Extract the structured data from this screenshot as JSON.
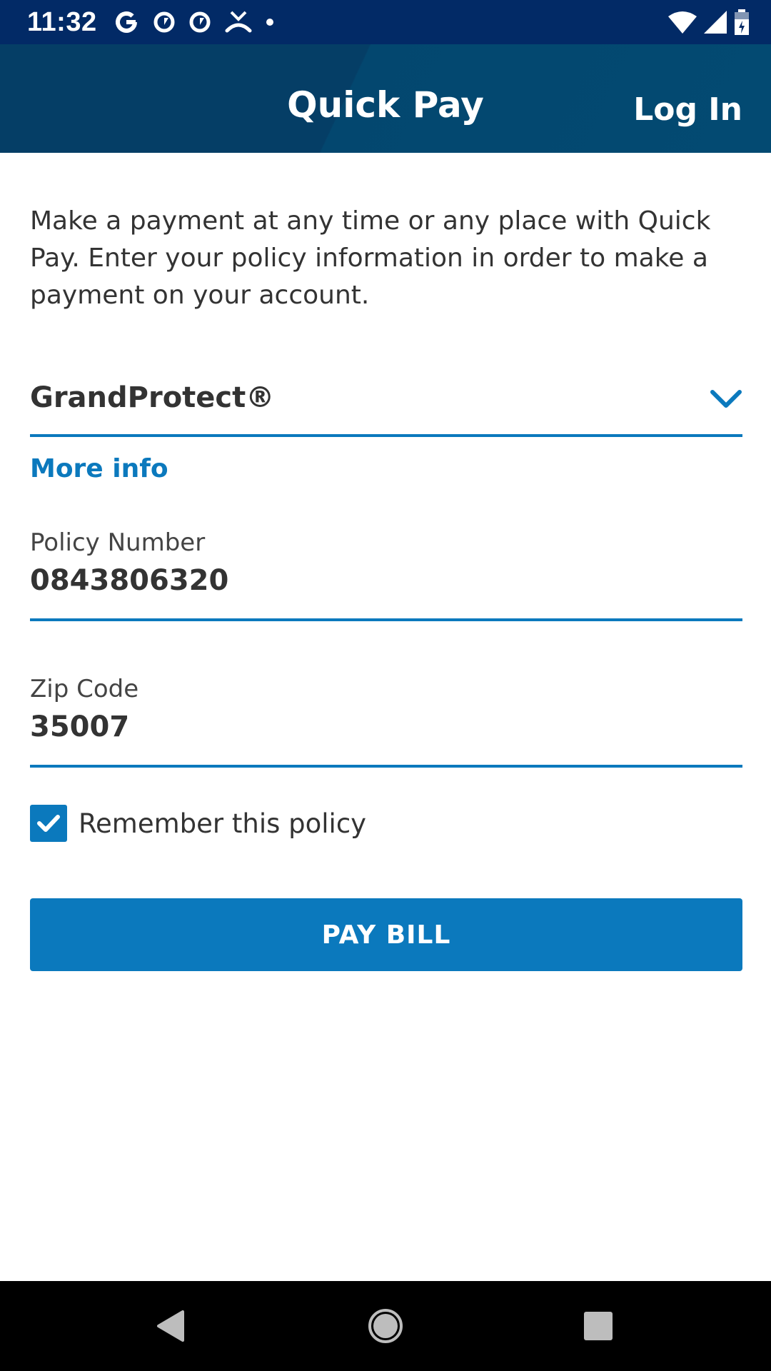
{
  "status_bar": {
    "time": "11:32",
    "left_icons": [
      "google-icon",
      "app-notification-icon",
      "app-notification-icon",
      "missed-call-icon",
      "dot-icon"
    ],
    "right_icons": [
      "wifi-icon",
      "cell-signal-icon",
      "battery-icon"
    ]
  },
  "header": {
    "title": "Quick Pay",
    "login_label": "Log In"
  },
  "intro_text": "Make a payment at any time or any place with Quick Pay. Enter your policy information in order to make a payment on your account.",
  "policy_type": {
    "selected": "GrandProtect®"
  },
  "more_info_label": "More info",
  "policy_number": {
    "label": "Policy Number",
    "value": "0843806320"
  },
  "zip_code": {
    "label": "Zip Code",
    "value": "35007"
  },
  "remember": {
    "label": "Remember this policy",
    "checked": true
  },
  "pay_button_label": "PAY BILL",
  "colors": {
    "status_bar": "#022a66",
    "header": "#053e66",
    "accent": "#0b79bd",
    "text": "#333333"
  }
}
